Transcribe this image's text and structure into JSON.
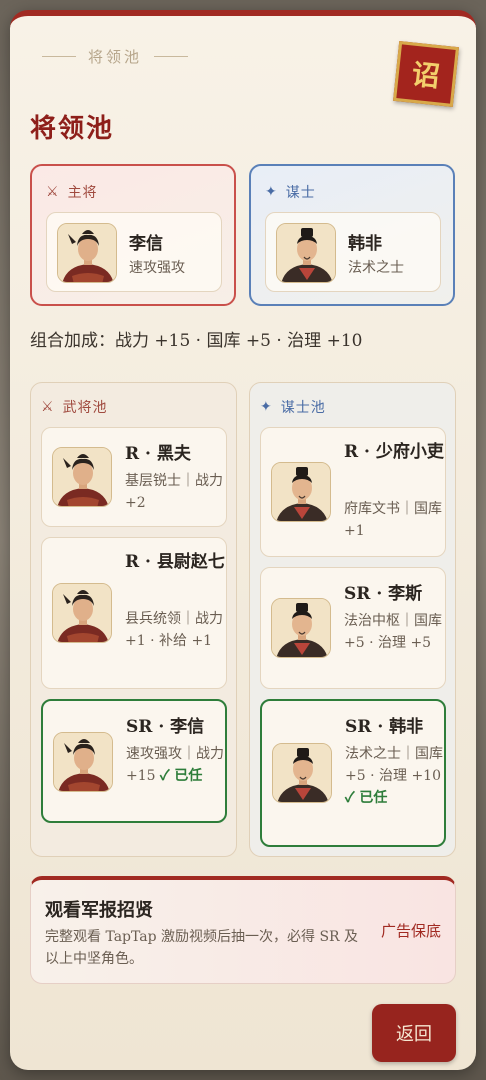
{
  "header": {
    "subtitle": "将领池",
    "seal_char": "诏",
    "title": "将领池"
  },
  "slots": {
    "general": {
      "label": "主将",
      "icon": "crossed-swords-icon",
      "name": "李信",
      "desc": "速攻强攻"
    },
    "advisor": {
      "label": "谋士",
      "icon": "star-icon",
      "name": "韩非",
      "desc": "法术之士"
    }
  },
  "bonus": "组合加成：战力 +15 · 国库 +5 · 治理 +10",
  "general_pool": {
    "label": "武将池",
    "cards": [
      {
        "name": "R · 黑夫",
        "desc": "基层锐士｜战力 +2",
        "active": false
      },
      {
        "name": "R · 县尉赵七",
        "desc": "县兵统领｜战力 +1 · 补给 +1",
        "active": false
      },
      {
        "name": "SR · 李信",
        "desc": "速攻强攻｜战力 +15",
        "status": "✓ 已任",
        "active": true
      }
    ]
  },
  "advisor_pool": {
    "label": "谋士池",
    "cards": [
      {
        "name": "R · 少府小吏",
        "desc": "府库文书｜国库 +1",
        "active": false
      },
      {
        "name": "SR · 李斯",
        "desc": "法治中枢｜国库 +5 · 治理 +5",
        "active": false
      },
      {
        "name": "SR · 韩非",
        "desc": "法术之士｜国库 +5 · 治理 +10",
        "status": "✓ 已任",
        "active": true
      }
    ]
  },
  "ad": {
    "title": "观看军报招贤",
    "desc": "完整观看 TapTap 激励视频后抽一次，必得 SR 及以上中坚角色。",
    "guarantee": "广告保底"
  },
  "buttons": {
    "back": "返回"
  },
  "colors": {
    "accent": "#a12a22",
    "general": "#c9504b",
    "advisor": "#5a80b8",
    "active": "#2e7d3a"
  }
}
